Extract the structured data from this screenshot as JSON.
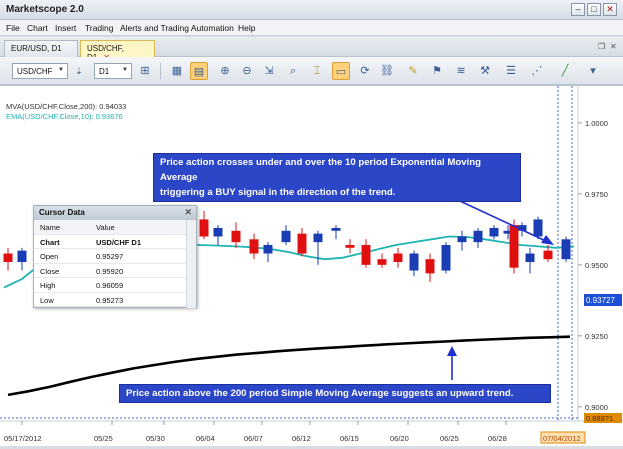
{
  "app": {
    "title": "Marketscope 2.0"
  },
  "window_controls": [
    "–",
    "□",
    "✕"
  ],
  "menu": [
    "File",
    "Chart",
    "Insert",
    "Trading",
    "Alerts and Trading Automation",
    "Help"
  ],
  "tabs": [
    {
      "label": "EUR/USD, D1",
      "active": false
    },
    {
      "label": "USD/CHF, D1",
      "active": true,
      "close": "✕"
    }
  ],
  "toolbar": {
    "symbol": "USD/CHF",
    "timeframe": "D1"
  },
  "indicators": {
    "mva": "MVA(USD/CHF.Close,200): 0.94033",
    "ema": "EMA(USD/CHF.Close,10): 0.93676",
    "mva_color": "#000000",
    "ema_color": "#1fb3b3"
  },
  "price_axis": {
    "ticks": [
      "1.0000",
      "0.9750",
      "0.9500",
      "0.9250",
      "0.9000"
    ],
    "current_ema": "0.93727",
    "current_mva": "0.888?1",
    "current_ema_color": "#1a4fd6",
    "current_mva_color": "#e08a00"
  },
  "date_axis": {
    "ticks": [
      "05/17/2012",
      "05/25",
      "05/30",
      "06/04",
      "06/07",
      "06/12",
      "06/15",
      "06/20",
      "06/25",
      "06/28"
    ],
    "current": "07/04/2012"
  },
  "chart_data": {
    "type": "candlestick",
    "ylim": [
      0.895,
      1.013
    ],
    "up_color": "#1a3db3",
    "down_color": "#e01010",
    "candles": [
      {
        "o": 0.954,
        "h": 0.956,
        "l": 0.948,
        "c": 0.951
      },
      {
        "o": 0.951,
        "h": 0.956,
        "l": 0.948,
        "c": 0.955
      },
      {
        "o": 0.966,
        "h": 0.969,
        "l": 0.959,
        "c": 0.96
      },
      {
        "o": 0.96,
        "h": 0.964,
        "l": 0.957,
        "c": 0.963
      },
      {
        "o": 0.962,
        "h": 0.965,
        "l": 0.956,
        "c": 0.958
      },
      {
        "o": 0.959,
        "h": 0.961,
        "l": 0.952,
        "c": 0.954
      },
      {
        "o": 0.954,
        "h": 0.958,
        "l": 0.951,
        "c": 0.957
      },
      {
        "o": 0.958,
        "h": 0.964,
        "l": 0.957,
        "c": 0.962
      },
      {
        "o": 0.961,
        "h": 0.963,
        "l": 0.953,
        "c": 0.954
      },
      {
        "o": 0.958,
        "h": 0.962,
        "l": 0.95,
        "c": 0.961
      },
      {
        "o": 0.962,
        "h": 0.964,
        "l": 0.959,
        "c": 0.963
      },
      {
        "o": 0.957,
        "h": 0.959,
        "l": 0.954,
        "c": 0.956
      },
      {
        "o": 0.957,
        "h": 0.959,
        "l": 0.949,
        "c": 0.95
      },
      {
        "o": 0.952,
        "h": 0.954,
        "l": 0.949,
        "c": 0.95
      },
      {
        "o": 0.954,
        "h": 0.956,
        "l": 0.949,
        "c": 0.951
      },
      {
        "o": 0.948,
        "h": 0.955,
        "l": 0.946,
        "c": 0.954
      },
      {
        "o": 0.952,
        "h": 0.954,
        "l": 0.944,
        "c": 0.947
      },
      {
        "o": 0.948,
        "h": 0.958,
        "l": 0.947,
        "c": 0.957
      },
      {
        "o": 0.958,
        "h": 0.962,
        "l": 0.955,
        "c": 0.96
      },
      {
        "o": 0.958,
        "h": 0.963,
        "l": 0.956,
        "c": 0.962
      },
      {
        "o": 0.96,
        "h": 0.964,
        "l": 0.959,
        "c": 0.963
      },
      {
        "o": 0.961,
        "h": 0.964,
        "l": 0.959,
        "c": 0.962
      },
      {
        "o": 0.962,
        "h": 0.965,
        "l": 0.96,
        "c": 0.964
      },
      {
        "o": 0.96,
        "h": 0.967,
        "l": 0.959,
        "c": 0.966
      },
      {
        "o": 0.964,
        "h": 0.966,
        "l": 0.947,
        "c": 0.949
      },
      {
        "o": 0.951,
        "h": 0.956,
        "l": 0.947,
        "c": 0.954
      },
      {
        "o": 0.955,
        "h": 0.957,
        "l": 0.951,
        "c": 0.952
      },
      {
        "o": 0.952,
        "h": 0.96,
        "l": 0.951,
        "c": 0.959
      }
    ],
    "ema_series": [
      0.942,
      0.945,
      0.95,
      0.954,
      0.9575,
      0.959,
      0.9595,
      0.959,
      0.9585,
      0.958,
      0.9575,
      0.957,
      0.9568,
      0.9565,
      0.9562,
      0.9555,
      0.9545,
      0.953,
      0.952,
      0.9525,
      0.954,
      0.9555,
      0.957,
      0.958,
      0.959,
      0.96,
      0.9598,
      0.959,
      0.958,
      0.957,
      0.9565,
      0.956,
      0.9565
    ],
    "mva_series": [
      0.9042,
      0.9055,
      0.907,
      0.9088,
      0.9105,
      0.912,
      0.9135,
      0.9147,
      0.9158,
      0.9168,
      0.9176,
      0.9184,
      0.919,
      0.9196,
      0.9201,
      0.9206,
      0.921,
      0.9215,
      0.9219,
      0.9223,
      0.9227,
      0.923,
      0.9234,
      0.9237,
      0.924,
      0.9243,
      0.9245,
      0.9247
    ]
  },
  "cursor_data": {
    "title": "Cursor Data",
    "close": "✕",
    "headers": [
      "Name",
      "Value"
    ],
    "rows": [
      {
        "name": "Chart",
        "value": "USD/CHF D1"
      },
      {
        "name": "Open",
        "value": "0.95297"
      },
      {
        "name": "Close",
        "value": "0.95920"
      },
      {
        "name": "High",
        "value": "0.96059"
      },
      {
        "name": "Low",
        "value": "0.95273"
      }
    ]
  },
  "annotations": {
    "top": "Price action crosses under and over the 10 period Exponential Moving Average triggering a BUY signal in the direction of the trend.",
    "top_line1": "Price action crosses under and over the 10 period Exponential Moving Average",
    "top_line2": "triggering a BUY signal in the direction of the trend.",
    "bottom": "Price action above the 200 period Simple Moving Average suggests an upward trend.",
    "arrow_color": "#1f2fd0"
  }
}
